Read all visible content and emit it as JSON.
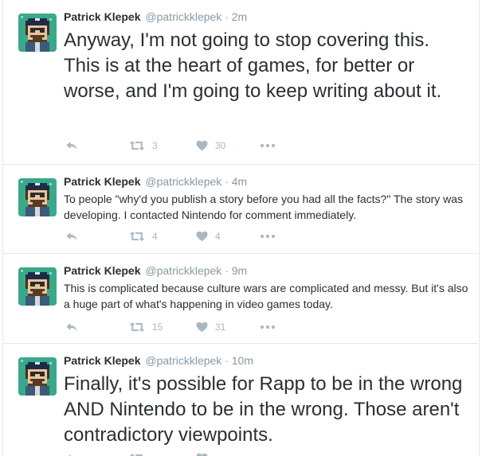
{
  "tweets": [
    {
      "name": "Patrick Klepek",
      "handle": "@patrickklepek",
      "separator": "·",
      "time": "2m",
      "text": "Anyway, I'm not going to stop covering this. This is at the heart of games, for better or worse, and I'm going to keep writing about it.",
      "text_size": "large",
      "retweets": "3",
      "likes": "30"
    },
    {
      "name": "Patrick Klepek",
      "handle": "@patrickklepek",
      "separator": "·",
      "time": "4m",
      "text": "To people \"why'd you publish a story before you had all the facts?\" The story was developing. I contacted Nintendo for comment immediately.",
      "text_size": "normal",
      "retweets": "4",
      "likes": "4"
    },
    {
      "name": "Patrick Klepek",
      "handle": "@patrickklepek",
      "separator": "·",
      "time": "9m",
      "text": "This is complicated because culture wars are complicated and messy. But it's also a huge part of what's happening in video games today.",
      "text_size": "normal",
      "retweets": "15",
      "likes": "31"
    },
    {
      "name": "Patrick Klepek",
      "handle": "@patrickklepek",
      "separator": "·",
      "time": "10m",
      "text": "Finally, it's possible for Rapp to be in the wrong AND Nintendo to be in the wrong. Those aren't contradictory viewpoints.",
      "text_size": "large",
      "retweets": "",
      "likes": ""
    }
  ],
  "icons": {
    "reply": "reply-icon",
    "retweet": "retweet-icon",
    "like": "heart-icon",
    "more": "more-dots-icon"
  },
  "colors": {
    "avatar_bg": "#3aa88a",
    "action_gray": "#aab8c2",
    "meta_gray": "#8899a6",
    "divider": "#e1e8ed"
  }
}
